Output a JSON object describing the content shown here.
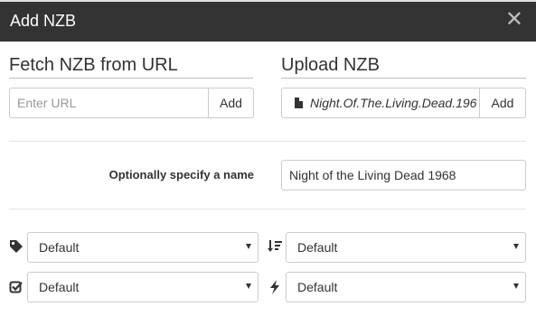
{
  "dialog": {
    "title": "Add NZB",
    "close_glyph": "✕"
  },
  "fetch": {
    "title": "Fetch NZB from URL",
    "url_placeholder": "Enter URL",
    "url_value": "",
    "add_label": "Add"
  },
  "upload": {
    "title": "Upload NZB",
    "file_name": "Night.Of.The.Living.Dead.196",
    "file_icon": "file-icon",
    "add_label": "Add"
  },
  "name": {
    "label": "Optionally specify a name",
    "value": "Night of the Living Dead 1968"
  },
  "options": {
    "category": {
      "icon": "tag-icon",
      "selected": "Default"
    },
    "priority": {
      "icon": "sort-amount-icon",
      "selected": "Default"
    },
    "postprocess": {
      "icon": "check-square-icon",
      "selected": "Default"
    },
    "script": {
      "icon": "bolt-icon",
      "selected": "Default"
    }
  },
  "colors": {
    "header_bg": "#333333",
    "header_text": "#ffffff",
    "border": "#cccccc"
  }
}
